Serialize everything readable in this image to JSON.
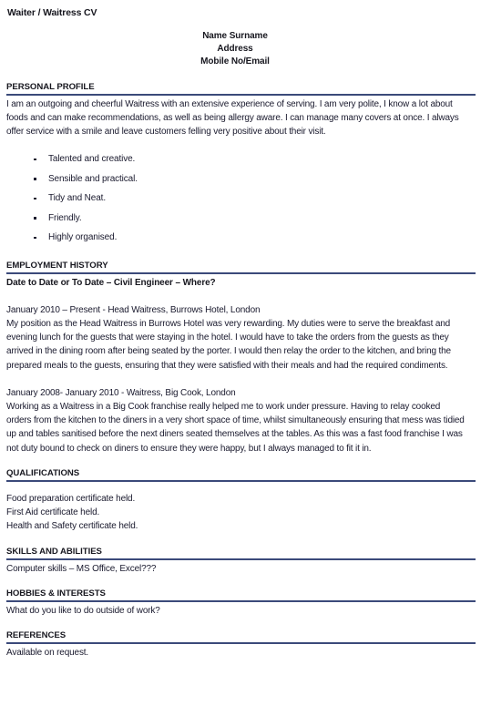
{
  "document": {
    "title": "Waiter / Waitress CV"
  },
  "contact": {
    "name": "Name Surname",
    "address": "Address",
    "contact_line": "Mobile No/Email"
  },
  "sections": {
    "personal_profile": {
      "heading": "PERSONAL PROFILE",
      "paragraph": "I am an outgoing and cheerful Waitress with an extensive experience of serving. I am very polite, I know a lot about foods and can make recommendations, as well as being allergy aware. I can manage many covers at once. I always offer service with a smile and leave customers felling very positive about their visit.",
      "bullets": [
        "Talented and creative.",
        "Sensible and practical.",
        "Tidy and Neat.",
        "Friendly.",
        "Highly organised."
      ]
    },
    "employment_history": {
      "heading": "EMPLOYMENT HISTORY",
      "template_line": "Date to Date or To Date – Civil Engineer – Where?",
      "jobs": [
        {
          "title_line": "January 2010 – Present -  Head Waitress, Burrows Hotel, London",
          "description": "My position as the Head Waitress in Burrows Hotel was very rewarding. My duties were to serve the breakfast and evening lunch for the guests that were staying in the hotel. I would have to take the orders from the guests as they arrived in the dining room after being seated by the porter. I would then relay the order to the kitchen, and bring the prepared meals to the guests, ensuring that they were satisfied with their meals and had the required condiments."
        },
        {
          "title_line": "January 2008- January 2010 -  Waitress, Big Cook, London",
          "description": "Working as a Waitress in a Big Cook franchise really helped me to work under pressure. Having to relay cooked orders from the kitchen to the diners in a very short space of time, whilst simultaneously ensuring that mess was tidied up and tables sanitised before the next diners seated themselves at the tables.  As this was a fast food franchise I was not duty bound to check on diners to ensure they were happy, but I always managed to fit it in."
        }
      ]
    },
    "qualifications": {
      "heading": "QUALIFICATIONS",
      "items": [
        "Food preparation certificate held.",
        "First Aid certificate held.",
        "Health and Safety certificate held."
      ]
    },
    "skills": {
      "heading": "SKILLS AND ABILITIES",
      "text": "Computer skills – MS Office, Excel???"
    },
    "hobbies": {
      "heading": "HOBBIES & INTERESTS",
      "text": "What do you like to do outside of work?"
    },
    "references": {
      "heading": "REFERENCES",
      "text": "Available on request."
    }
  },
  "colors": {
    "rule": "#3b4a7a",
    "text": "#1a1a2e",
    "heading": "#17171f"
  }
}
